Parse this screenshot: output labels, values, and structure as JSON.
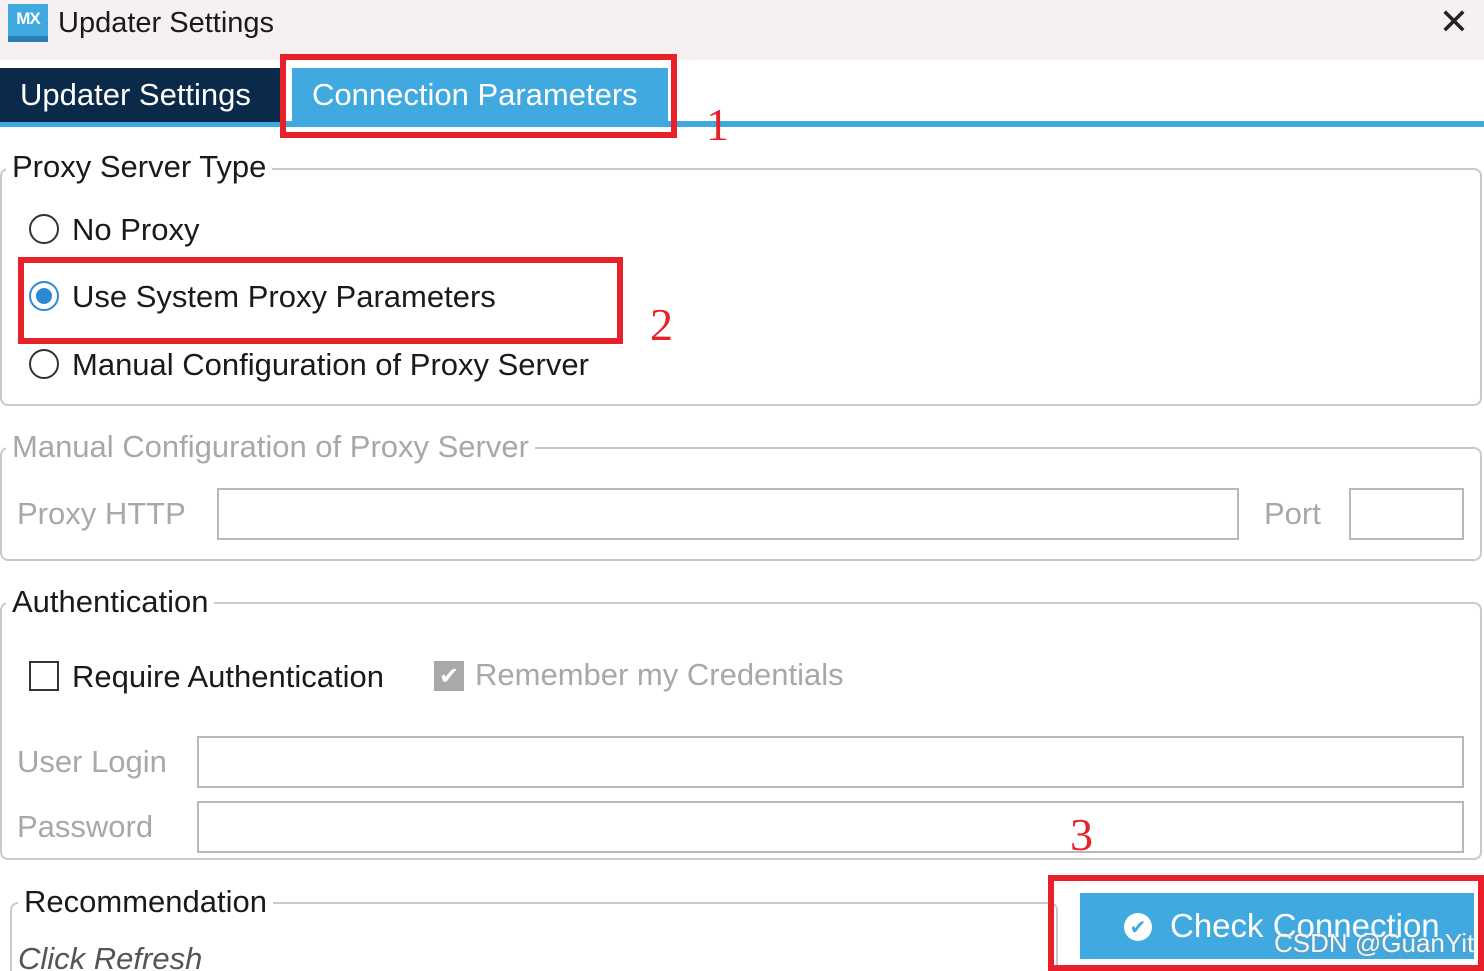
{
  "window": {
    "app_icon_text": "MX",
    "title": "Updater Settings",
    "close_glyph": "✕"
  },
  "tabs": [
    {
      "label": "Updater Settings",
      "active": false
    },
    {
      "label": "Connection Parameters",
      "active": true
    }
  ],
  "proxy_type": {
    "legend": "Proxy Server Type",
    "options": [
      {
        "label": "No Proxy",
        "selected": false
      },
      {
        "label": "Use System Proxy Parameters",
        "selected": true
      },
      {
        "label": "Manual Configuration of Proxy Server",
        "selected": false
      }
    ]
  },
  "manual_proxy": {
    "legend": "Manual Configuration of Proxy Server",
    "proxy_http_label": "Proxy HTTP",
    "proxy_http_value": "",
    "port_label": "Port",
    "port_value": ""
  },
  "authentication": {
    "legend": "Authentication",
    "require_label": "Require Authentication",
    "require_checked": false,
    "remember_label": "Remember my Credentials",
    "remember_checked": true,
    "remember_check_glyph": "✔",
    "user_login_label": "User Login",
    "user_login_value": "",
    "password_label": "Password",
    "password_value": ""
  },
  "recommendation": {
    "legend": "Recommendation",
    "hint": "Click Refresh"
  },
  "check_connection": {
    "label": "Check Connection",
    "icon": "check-circle-icon",
    "icon_glyph": "✔"
  },
  "annotations": [
    "1",
    "2",
    "3"
  ],
  "watermark": "CSDN @GuanYit",
  "colors": {
    "accent": "#3fa9e0",
    "tab_dark": "#0b2a4a",
    "annotation_red": "#e8202a",
    "disabled_text": "#a8a8a8"
  }
}
